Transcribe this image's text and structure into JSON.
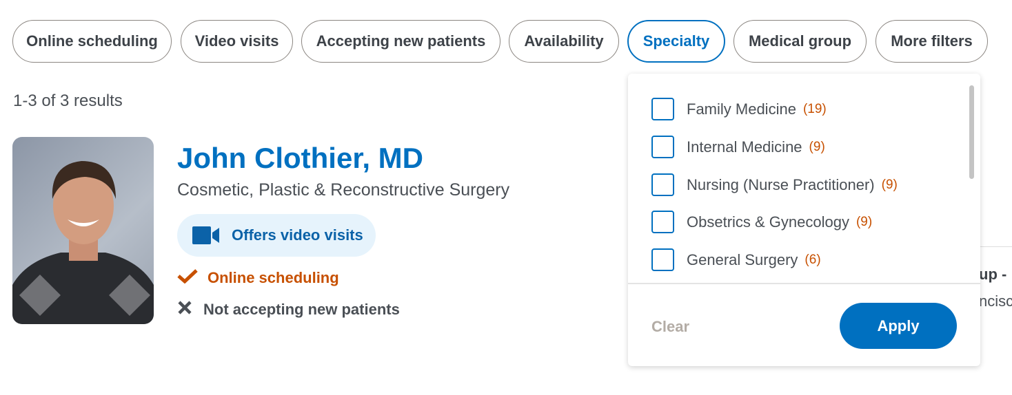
{
  "filters": [
    {
      "label": "Online scheduling",
      "active": false
    },
    {
      "label": "Video visits",
      "active": false
    },
    {
      "label": "Accepting new patients",
      "active": false
    },
    {
      "label": "Availability",
      "active": false
    },
    {
      "label": "Specialty",
      "active": true
    },
    {
      "label": "Medical group",
      "active": false
    },
    {
      "label": "More filters",
      "active": false
    }
  ],
  "results_count": "1-3 of 3 results",
  "provider": {
    "name": "John Clothier, MD",
    "specialty": "Cosmetic, Plastic & Reconstructive Surgery",
    "video_badge": "Offers video visits",
    "online_scheduling": "Online scheduling",
    "accepting": "Not accepting new patients"
  },
  "background_text": {
    "line1": "up -",
    "line2": "ncisc"
  },
  "specialty_dropdown": {
    "options": [
      {
        "label": "Family Medicine",
        "count": "(19)",
        "checked": false
      },
      {
        "label": "Internal Medicine",
        "count": "(9)",
        "checked": false
      },
      {
        "label": "Nursing (Nurse Practitioner)",
        "count": "(9)",
        "checked": false
      },
      {
        "label": "Obsetrics & Gynecology",
        "count": "(9)",
        "checked": false
      },
      {
        "label": "General Surgery",
        "count": "(6)",
        "checked": false
      }
    ],
    "clear_label": "Clear",
    "apply_label": "Apply"
  },
  "colors": {
    "accent": "#0070c0",
    "orange": "#c75000",
    "badge_bg": "#e6f3fc"
  }
}
